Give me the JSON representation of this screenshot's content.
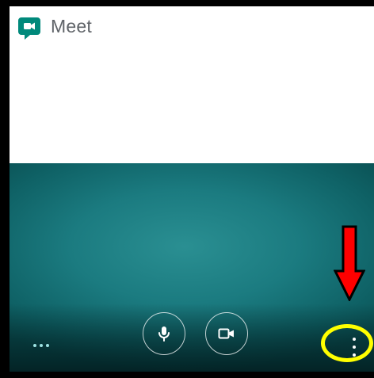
{
  "app": {
    "title": "Meet",
    "logo_icon": "google-meet-logo-icon",
    "brand_color": "#00897b"
  },
  "video": {
    "background_color": "#1b7b80"
  },
  "controls": {
    "mic_icon": "microphone-icon",
    "camera_icon": "video-camera-icon",
    "left_menu_icon": "horizontal-dots-icon",
    "more_options_icon": "vertical-dots-icon"
  },
  "annotations": {
    "arrow_color": "#ff0000",
    "highlight_color": "#ffff00"
  }
}
